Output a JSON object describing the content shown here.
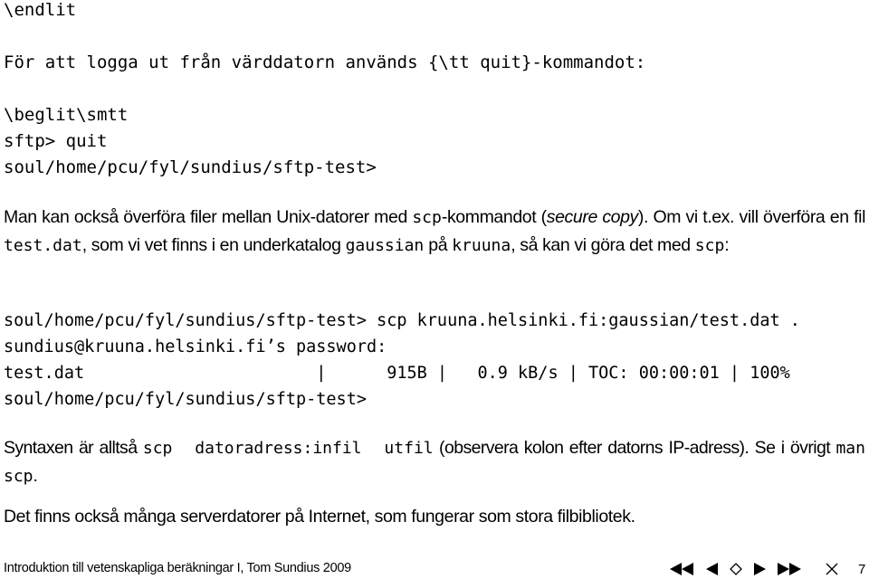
{
  "document": {
    "lines": {
      "endlit": "\\endlit",
      "logout_intro": "För att logga ut från värddatorn används {\\tt quit}-kommandot:",
      "beglit": "\\beglit\\smtt",
      "sftp_quit": "sftp> quit",
      "prompt_1": "soul/home/pcu/fyl/sundius/sftp-test>"
    },
    "scp_paragraph": {
      "t1": "Man kan också överföra filer mellan Unix-datorer med ",
      "c1": "scp",
      "t2": "-kommandot (",
      "em1": "secure copy",
      "t3": "). Om vi t.ex. vill överföra en fil ",
      "c2": "test.dat",
      "t4": ", som vi vet finns i en underkatalog ",
      "c3": "gaussian",
      "t5": " på ",
      "c4": "kruuna",
      "t6": ", så kan vi göra det med ",
      "c5": "scp",
      "t7": ":"
    },
    "terminal": {
      "cmd_line": "soul/home/pcu/fyl/sundius/sftp-test> scp kruuna.helsinki.fi:gaussian/test.dat .",
      "password_line": "sundius@kruuna.helsinki.fi’s password:",
      "transfer_line": "test.dat                       |      915B |   0.9 kB/s | TOC: 00:00:01 | 100%",
      "prompt_2": "soul/home/pcu/fyl/sundius/sftp-test>"
    },
    "syntax_paragraph": {
      "t1": "Syntaxen är alltså ",
      "c1": "scp  datoradress:infil  utfil",
      "t2": " (observera kolon efter datorns IP-adress). Se i övrigt ",
      "c2": "man scp",
      "t3": "."
    },
    "servers_paragraph": "Det finns också många serverdatorer på Internet, som fungerar som stora filbibliotek."
  },
  "footer": {
    "title": "Introduktion till vetenskapliga beräkningar I, Tom Sundius 2009",
    "nav_icons": [
      "first-page-icon",
      "previous-page-icon",
      "back-icon",
      "next-page-icon",
      "last-page-icon",
      "close-icon"
    ],
    "page_number": "7"
  }
}
